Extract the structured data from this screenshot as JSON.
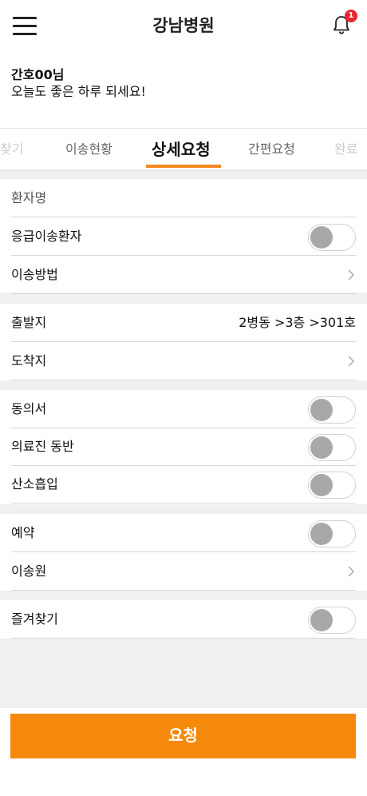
{
  "header": {
    "title": "강남병원",
    "notification_count": "1"
  },
  "greeting": {
    "name": "간호00님",
    "message": "오늘도 좋은 하루 되세요!"
  },
  "tabs": [
    "찾기",
    "이송현황",
    "상세요청",
    "간편요청",
    "완료"
  ],
  "active_tab": "상세요청",
  "accent_color": "#f5891f",
  "form": {
    "patient_name_label": "환자명",
    "emergency_label": "응급이송환자",
    "method_label": "이송방법",
    "origin_label": "출발지",
    "origin_value": "2병동 >3층 >301호",
    "destination_label": "도착지",
    "consent_label": "동의서",
    "medical_staff_label": "의료진 동반",
    "oxygen_label": "산소흡입",
    "reservation_label": "예약",
    "transporter_label": "이송원",
    "favorite_label": "즐겨찾기"
  },
  "toggles": {
    "emergency": false,
    "consent": false,
    "medical_staff": false,
    "oxygen": false,
    "reservation": false,
    "favorite": false
  },
  "submit_label": "요청"
}
